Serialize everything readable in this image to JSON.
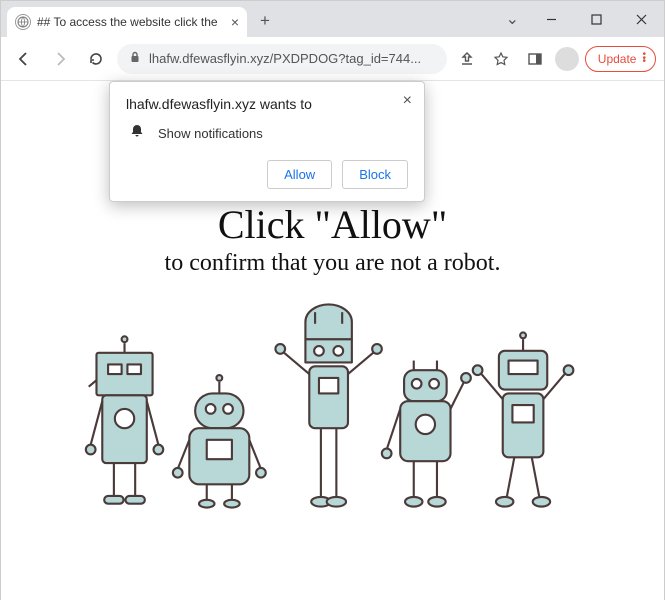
{
  "window": {
    "tab_title": "## To access the website click the",
    "url": "lhafw.dfewasflyin.xyz/PXDPDOG?tag_id=744..."
  },
  "toolbar": {
    "update_label": "Update"
  },
  "popup": {
    "host": "lhafw.dfewasflyin.xyz wants to",
    "permission": "Show notifications",
    "allow": "Allow",
    "block": "Block"
  },
  "page": {
    "headline": "Click \"Allow\"",
    "subline": "to confirm that you are not a robot."
  }
}
